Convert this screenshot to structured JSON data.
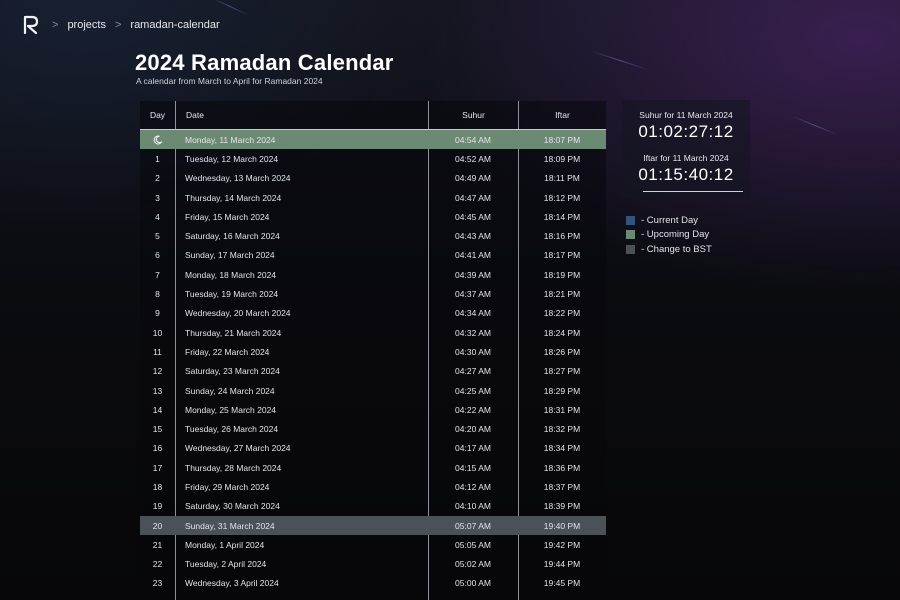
{
  "breadcrumb": {
    "sep": ">",
    "items": [
      "projects",
      "ramadan-calendar"
    ]
  },
  "page": {
    "title": "2024 Ramadan Calendar",
    "subtitle": "A calendar from March to April for Ramadan 2024"
  },
  "table": {
    "headers": {
      "day": "Day",
      "date": "Date",
      "suhur": "Suhur",
      "iftar": "Iftar"
    },
    "rows": [
      {
        "day": "",
        "date": "Monday, 11 March 2024",
        "suhur": "04:54 AM",
        "iftar": "18:07 PM",
        "state": "current",
        "icon": "moon-icon"
      },
      {
        "day": "1",
        "date": "Tuesday, 12 March 2024",
        "suhur": "04:52 AM",
        "iftar": "18:09 PM",
        "state": ""
      },
      {
        "day": "2",
        "date": "Wednesday, 13 March 2024",
        "suhur": "04:49 AM",
        "iftar": "18:11 PM",
        "state": ""
      },
      {
        "day": "3",
        "date": "Thursday, 14 March 2024",
        "suhur": "04:47 AM",
        "iftar": "18:12 PM",
        "state": ""
      },
      {
        "day": "4",
        "date": "Friday, 15 March 2024",
        "suhur": "04:45 AM",
        "iftar": "18:14 PM",
        "state": ""
      },
      {
        "day": "5",
        "date": "Saturday, 16 March 2024",
        "suhur": "04:43 AM",
        "iftar": "18:16 PM",
        "state": ""
      },
      {
        "day": "6",
        "date": "Sunday, 17 March 2024",
        "suhur": "04:41 AM",
        "iftar": "18:17 PM",
        "state": ""
      },
      {
        "day": "7",
        "date": "Monday, 18 March 2024",
        "suhur": "04:39 AM",
        "iftar": "18:19 PM",
        "state": ""
      },
      {
        "day": "8",
        "date": "Tuesday, 19 March 2024",
        "suhur": "04:37 AM",
        "iftar": "18:21 PM",
        "state": ""
      },
      {
        "day": "9",
        "date": "Wednesday, 20 March 2024",
        "suhur": "04:34 AM",
        "iftar": "18:22 PM",
        "state": ""
      },
      {
        "day": "10",
        "date": "Thursday, 21 March 2024",
        "suhur": "04:32 AM",
        "iftar": "18:24 PM",
        "state": ""
      },
      {
        "day": "11",
        "date": "Friday, 22 March 2024",
        "suhur": "04:30 AM",
        "iftar": "18:26 PM",
        "state": ""
      },
      {
        "day": "12",
        "date": "Saturday, 23 March 2024",
        "suhur": "04:27 AM",
        "iftar": "18:27 PM",
        "state": ""
      },
      {
        "day": "13",
        "date": "Sunday, 24 March 2024",
        "suhur": "04:25 AM",
        "iftar": "18:29 PM",
        "state": ""
      },
      {
        "day": "14",
        "date": "Monday, 25 March 2024",
        "suhur": "04:22 AM",
        "iftar": "18:31 PM",
        "state": ""
      },
      {
        "day": "15",
        "date": "Tuesday, 26 March 2024",
        "suhur": "04:20 AM",
        "iftar": "18:32 PM",
        "state": ""
      },
      {
        "day": "16",
        "date": "Wednesday, 27 March 2024",
        "suhur": "04:17 AM",
        "iftar": "18:34 PM",
        "state": ""
      },
      {
        "day": "17",
        "date": "Thursday, 28 March 2024",
        "suhur": "04:15 AM",
        "iftar": "18:36 PM",
        "state": ""
      },
      {
        "day": "18",
        "date": "Friday, 29 March 2024",
        "suhur": "04:12 AM",
        "iftar": "18:37 PM",
        "state": ""
      },
      {
        "day": "19",
        "date": "Saturday, 30 March 2024",
        "suhur": "04:10 AM",
        "iftar": "18:39 PM",
        "state": ""
      },
      {
        "day": "20",
        "date": "Sunday, 31 March 2024",
        "suhur": "05:07 AM",
        "iftar": "19:40 PM",
        "state": "bst"
      },
      {
        "day": "21",
        "date": "Monday, 1 April 2024",
        "suhur": "05:05 AM",
        "iftar": "19:42 PM",
        "state": ""
      },
      {
        "day": "22",
        "date": "Tuesday, 2 April 2024",
        "suhur": "05:02 AM",
        "iftar": "19:44 PM",
        "state": ""
      },
      {
        "day": "23",
        "date": "Wednesday, 3 April 2024",
        "suhur": "05:00 AM",
        "iftar": "19:45 PM",
        "state": ""
      }
    ]
  },
  "countdown": {
    "suhur_label": "Suhur for 11 March 2024",
    "suhur_time": "01:02:27:12",
    "iftar_label": "Iftar for 11 March 2024",
    "iftar_time": "01:15:40:12"
  },
  "legend": [
    {
      "label": "- Current Day",
      "color": "#34527e"
    },
    {
      "label": "- Upcoming Day",
      "color": "#6c8a73"
    },
    {
      "label": "- Change to BST",
      "color": "#4a5257"
    }
  ],
  "colors": {
    "current_row": "#6c8a73",
    "bst_row": "#4a5257"
  }
}
